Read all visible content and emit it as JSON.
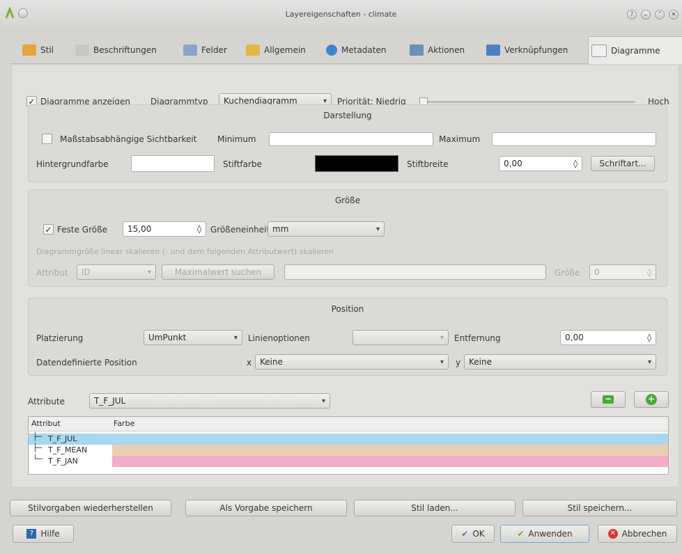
{
  "window": {
    "title": "Layereigenschaften - climate"
  },
  "tabs": [
    {
      "label": "Stil",
      "icon": "style-icon",
      "color": "#e8a33a"
    },
    {
      "label": "Beschriftungen",
      "icon": "labels-icon",
      "color": "#c9c7c3"
    },
    {
      "label": "Felder",
      "icon": "fields-icon",
      "color": "#8aa5c8"
    },
    {
      "label": "Allgemein",
      "icon": "general-icon",
      "color": "#e2b845"
    },
    {
      "label": "Metadaten",
      "icon": "metadata-icon",
      "color": "#3f82cf"
    },
    {
      "label": "Aktionen",
      "icon": "actions-icon",
      "color": "#6b8fb8"
    },
    {
      "label": "Verknüpfungen",
      "icon": "joins-icon",
      "color": "#4a7fc6"
    },
    {
      "label": "Diagramme",
      "icon": "diagrams-icon",
      "color": "#f0f0f0"
    }
  ],
  "top": {
    "show_label": "Diagramme anzeigen",
    "type_label": "Diagrammtyp",
    "type_value": "Kuchendiagramm",
    "priority_label": "Priorität: Niedrig",
    "priority_high": "Hoch",
    "priority_level": 0.0
  },
  "darstellung": {
    "title": "Darstellung",
    "scale_label": "Maßstabsabhängige Sichtbarkeit",
    "min_label": "Minimum",
    "max_label": "Maximum",
    "bg_label": "Hintergrundfarbe",
    "pen_label": "Stiftfarbe",
    "penwidth_label": "Stiftbreite",
    "penwidth_value": "0,00",
    "font_button": "Schriftart...",
    "bg_color": "#ffffff",
    "pen_color": "#000000"
  },
  "groesse": {
    "title": "Größe",
    "fixed_label": "Feste Größe",
    "fixed_value": "15,00",
    "unit_label": "Größeneinheit",
    "unit_value": "mm",
    "linear_label": "Diagrammgröße linear skalieren (- und dem folgenden Attributwert) skalieren",
    "attr_label": "Attribut",
    "attr_value": "ID",
    "find_max_button": "Maximalwert suchen",
    "size_label": "Größe",
    "size_value": "0"
  },
  "position": {
    "title": "Position",
    "placement_label": "Platzierung",
    "placement_value": "UmPunkt",
    "line_options_label": "Linienoptionen",
    "distance_label": "Entfernung",
    "distance_value": "0,00",
    "data_defined_label": "Datendefinierte Position",
    "x_label": "x",
    "x_value": "Keine",
    "y_label": "y",
    "y_value": "Keine"
  },
  "attributes": {
    "label": "Attribute",
    "value": "T_F_JUL",
    "col_attr": "Attribut",
    "col_color": "Farbe",
    "rows": [
      {
        "name": "T_F_JUL",
        "color": "#a6d8f0",
        "selected": true
      },
      {
        "name": "T_F_MEAN",
        "color": "#e9cfb1",
        "selected": false
      },
      {
        "name": "T_F_JAN",
        "color": "#f2aec8",
        "selected": false
      }
    ]
  },
  "bottom": {
    "restore": "Stilvorgaben wiederherstellen",
    "save_default": "Als Vorgabe speichern",
    "load_style": "Stil laden...",
    "save_style": "Stil speichern...",
    "help": "Hilfe",
    "ok": "OK",
    "apply": "Anwenden",
    "cancel": "Abbrechen"
  }
}
